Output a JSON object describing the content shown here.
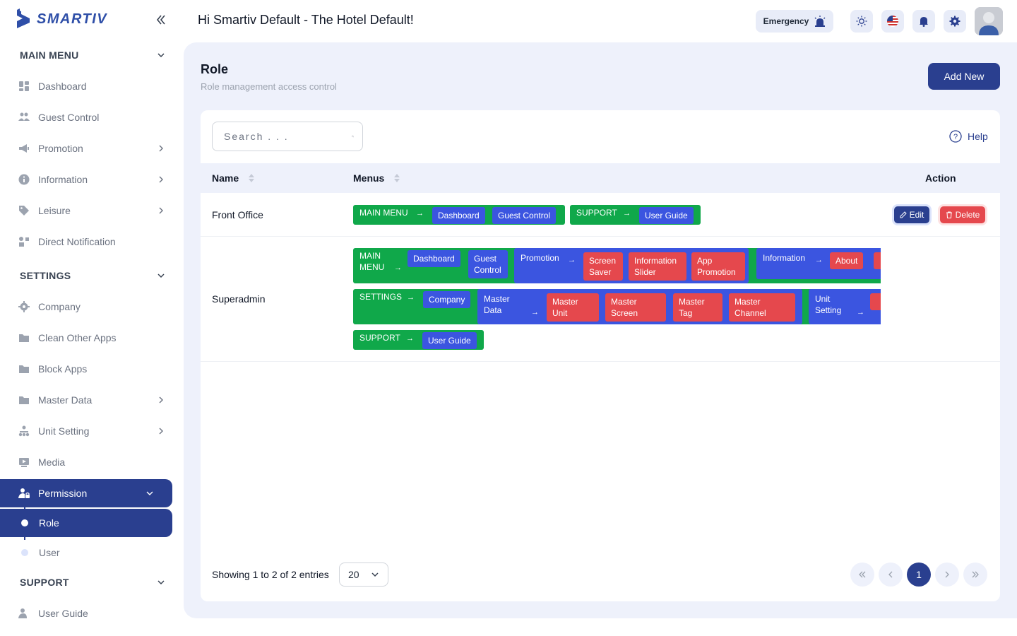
{
  "brand": {
    "name": "SMARTIV"
  },
  "header": {
    "greeting": "Hi Smartiv Default - The Hotel Default!",
    "emergency_label": "Emergency"
  },
  "sidebar": {
    "main_menu": {
      "title": "MAIN MENU",
      "items": [
        {
          "label": "Dashboard",
          "icon": "dashboard-icon"
        },
        {
          "label": "Guest Control",
          "icon": "users-icon"
        },
        {
          "label": "Promotion",
          "icon": "megaphone-icon"
        },
        {
          "label": "Information",
          "icon": "info-icon"
        },
        {
          "label": "Leisure",
          "icon": "tag-icon"
        },
        {
          "label": "Direct Notification",
          "icon": "notification-icon"
        }
      ]
    },
    "settings": {
      "title": "SETTINGS",
      "items": [
        {
          "label": "Company",
          "icon": "gear-icon"
        },
        {
          "label": "Clean Other Apps",
          "icon": "folder-icon"
        },
        {
          "label": "Block Apps",
          "icon": "folder-icon"
        },
        {
          "label": "Master Data",
          "icon": "folder-icon"
        },
        {
          "label": "Unit Setting",
          "icon": "sitemap-icon"
        },
        {
          "label": "Media",
          "icon": "media-icon"
        },
        {
          "label": "Permission",
          "icon": "user-lock-icon"
        }
      ],
      "permission_sub": [
        {
          "label": "Role"
        },
        {
          "label": "User"
        }
      ]
    },
    "support": {
      "title": "SUPPORT",
      "items": [
        {
          "label": "User Guide",
          "icon": "user-guide-icon"
        }
      ]
    }
  },
  "page": {
    "title": "Role",
    "subtitle": "Role management access control",
    "add_button": "Add New"
  },
  "table": {
    "search_placeholder": "Search . . .",
    "help_label": "Help",
    "columns": {
      "name": "Name",
      "menus": "Menus",
      "action": "Action"
    },
    "actions": {
      "edit": "Edit",
      "delete": "Delete"
    },
    "rows": [
      {
        "name": "Front Office",
        "groups": [
          {
            "label": "MAIN MENU",
            "chips": [
              "Dashboard",
              "Guest Control"
            ]
          },
          {
            "label": "SUPPORT",
            "chips": [
              "User Guide"
            ]
          }
        ]
      },
      {
        "name": "Superadmin",
        "groups": [
          {
            "label": "MAIN MENU",
            "chips": [
              "Dashboard",
              "Guest Control",
              "Promotion",
              "Screen Saver",
              "Information Slider",
              "App Promotion",
              "Information",
              "About"
            ]
          },
          {
            "label": "SETTINGS",
            "chips": [
              "Company",
              "Master Data",
              "Master Unit",
              "Master Screen",
              "Master Tag",
              "Master Channel",
              "Unit Setting"
            ]
          },
          {
            "label": "SUPPORT",
            "chips": [
              "User Guide"
            ]
          }
        ]
      }
    ]
  },
  "pagination": {
    "info": "Showing 1 to 2 of 2 entries",
    "page_size": "20",
    "current_page": "1"
  },
  "colors": {
    "primary": "#2a3f8f",
    "group_green": "#10a84a",
    "chip_blue": "#3b55e0",
    "chip_red": "#e5484d",
    "panel_bg": "#eef1fb"
  }
}
